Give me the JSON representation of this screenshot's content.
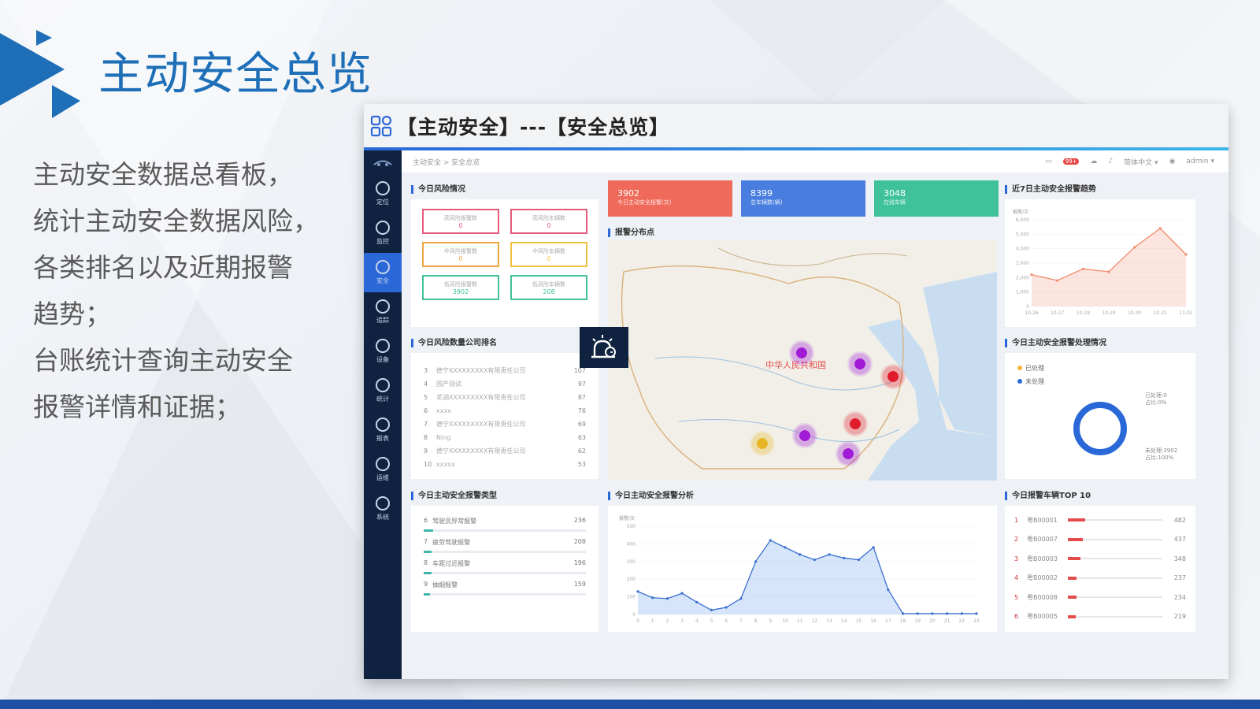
{
  "slide": {
    "title": "主动安全总览",
    "description": [
      "主动安全数据总看板，",
      "统计主动安全数据风险，",
      "各类排名以及近期报警",
      "趋势；",
      "台账统计查询主动安全",
      "报警详情和证据；"
    ]
  },
  "frame": {
    "title": "【主动安全】---【安全总览】"
  },
  "sidebar": {
    "items": [
      {
        "label": "定位",
        "icon": "location-icon"
      },
      {
        "label": "监控",
        "icon": "camera-icon"
      },
      {
        "label": "安全",
        "icon": "shield-icon",
        "active": true
      },
      {
        "label": "追踪",
        "icon": "target-icon"
      },
      {
        "label": "设备",
        "icon": "device-icon"
      },
      {
        "label": "统计",
        "icon": "chart-icon"
      },
      {
        "label": "报表",
        "icon": "report-icon"
      },
      {
        "label": "运维",
        "icon": "tools-icon"
      },
      {
        "label": "系统",
        "icon": "gear-icon"
      }
    ]
  },
  "topnav": {
    "breadcrumb": "主动安全 > 安全总览",
    "language": "简体中文 ▾",
    "user": "admin ▾",
    "badge": "99+"
  },
  "risk": {
    "title": "今日风险情况",
    "boxes": [
      {
        "label": "高风险报警数",
        "value": "0",
        "color": "#e55a7a"
      },
      {
        "label": "高风险车辆数",
        "value": "0",
        "color": "#e55a7a"
      },
      {
        "label": "中风险报警数",
        "value": "0",
        "color": "#f0a640"
      },
      {
        "label": "中风险车辆数",
        "value": "0",
        "color": "#f0c040"
      },
      {
        "label": "低风险报警数",
        "value": "3902",
        "color": "#3fc29a"
      },
      {
        "label": "低风险车辆数",
        "value": "208",
        "color": "#3fc29a"
      }
    ]
  },
  "stats": [
    {
      "value": "3902",
      "label": "今日主动安全报警(次)",
      "color": "#ef6a5a"
    },
    {
      "value": "8399",
      "label": "总车辆数(辆)",
      "color": "#4a7de0"
    },
    {
      "value": "3048",
      "label": "在线车辆",
      "color": "#3fc29a"
    }
  ],
  "map": {
    "title": "报警分布点",
    "country_label": "中华人民共和国",
    "clusters": [
      "",
      "",
      "",
      "",
      "",
      "",
      ""
    ]
  },
  "trend": {
    "title": "近7日主动安全报警趋势",
    "ylabel": "报警/次",
    "yticks": [
      "6,000",
      "5,000",
      "4,000",
      "3,000",
      "2,000",
      "1,000",
      "0"
    ],
    "xticks": [
      "10-26",
      "10-27",
      "10-28",
      "10-29",
      "10-30",
      "10-31",
      "11-01"
    ]
  },
  "ranking": {
    "title": "今日风险数量公司排名",
    "rows": [
      {
        "n": "3",
        "name": "德宁XXXXXXXXX有限责任公司",
        "v": "107"
      },
      {
        "n": "4",
        "name": "国产测试",
        "v": "97"
      },
      {
        "n": "5",
        "name": "芜湖XXXXXXXXX有限责任公司",
        "v": "87"
      },
      {
        "n": "6",
        "name": "xxxx",
        "v": "76"
      },
      {
        "n": "7",
        "name": "德宁XXXXXXXXX有限责任公司",
        "v": "69"
      },
      {
        "n": "8",
        "name": "Ning",
        "v": "63"
      },
      {
        "n": "9",
        "name": "德宁XXXXXXXXX有限责任公司",
        "v": "62"
      },
      {
        "n": "10",
        "name": "xxxxx",
        "v": "53"
      }
    ]
  },
  "handling": {
    "title": "今日主动安全报警处理情况",
    "legend": [
      "已处理",
      "未处理"
    ],
    "label_processed": "已处理:0",
    "pct_processed": "占比:0%",
    "label_unprocessed": "未处理:3902",
    "pct_unprocessed": "占比:100%"
  },
  "types": {
    "title": "今日主动安全报警类型",
    "rows": [
      {
        "n": "6",
        "name": "驾驶员异常报警",
        "v": "236",
        "fill": 0.06
      },
      {
        "n": "7",
        "name": "疲劳驾驶报警",
        "v": "208",
        "fill": 0.05
      },
      {
        "n": "8",
        "name": "车距过近报警",
        "v": "196",
        "fill": 0.05
      },
      {
        "n": "9",
        "name": "抽烟报警",
        "v": "159",
        "fill": 0.04
      }
    ]
  },
  "analysis": {
    "title": "今日主动安全报警分析",
    "ylabel": "报警/次",
    "yticks": [
      "500",
      "400",
      "300",
      "200",
      "100",
      "0"
    ]
  },
  "top10": {
    "title": "今日报警车辆TOP 10",
    "rows": [
      {
        "i": "1",
        "name": "粤B00001",
        "v": "482",
        "fill": 0.18
      },
      {
        "i": "2",
        "name": "粤B00007",
        "v": "437",
        "fill": 0.16
      },
      {
        "i": "3",
        "name": "粤B00003",
        "v": "348",
        "fill": 0.13
      },
      {
        "i": "4",
        "name": "粤B00002",
        "v": "237",
        "fill": 0.09
      },
      {
        "i": "5",
        "name": "粤B00008",
        "v": "234",
        "fill": 0.09
      },
      {
        "i": "6",
        "name": "粤B00005",
        "v": "219",
        "fill": 0.08
      }
    ]
  },
  "chart_data": [
    {
      "type": "area",
      "title": "近7日主动安全报警趋势",
      "ylabel": "报警/次",
      "categories": [
        "10-26",
        "10-27",
        "10-28",
        "10-29",
        "10-30",
        "10-31",
        "11-01"
      ],
      "values": [
        2200,
        1800,
        2600,
        2400,
        4100,
        5400,
        3600
      ],
      "ylim": [
        0,
        6000
      ]
    },
    {
      "type": "area",
      "title": "今日主动安全报警分析",
      "ylabel": "报警/次",
      "categories": [
        "0",
        "1",
        "2",
        "3",
        "4",
        "5",
        "6",
        "7",
        "8",
        "9",
        "10",
        "11",
        "12",
        "13",
        "14",
        "15",
        "16",
        "17",
        "18",
        "19",
        "20",
        "21",
        "22",
        "23"
      ],
      "values": [
        130,
        95,
        90,
        120,
        70,
        25,
        40,
        90,
        300,
        420,
        380,
        340,
        310,
        340,
        320,
        310,
        380,
        140,
        5,
        5,
        5,
        5,
        5,
        5
      ],
      "ylim": [
        0,
        500
      ]
    },
    {
      "type": "pie",
      "title": "今日主动安全报警处理情况",
      "categories": [
        "已处理",
        "未处理"
      ],
      "values": [
        0,
        3902
      ]
    }
  ]
}
